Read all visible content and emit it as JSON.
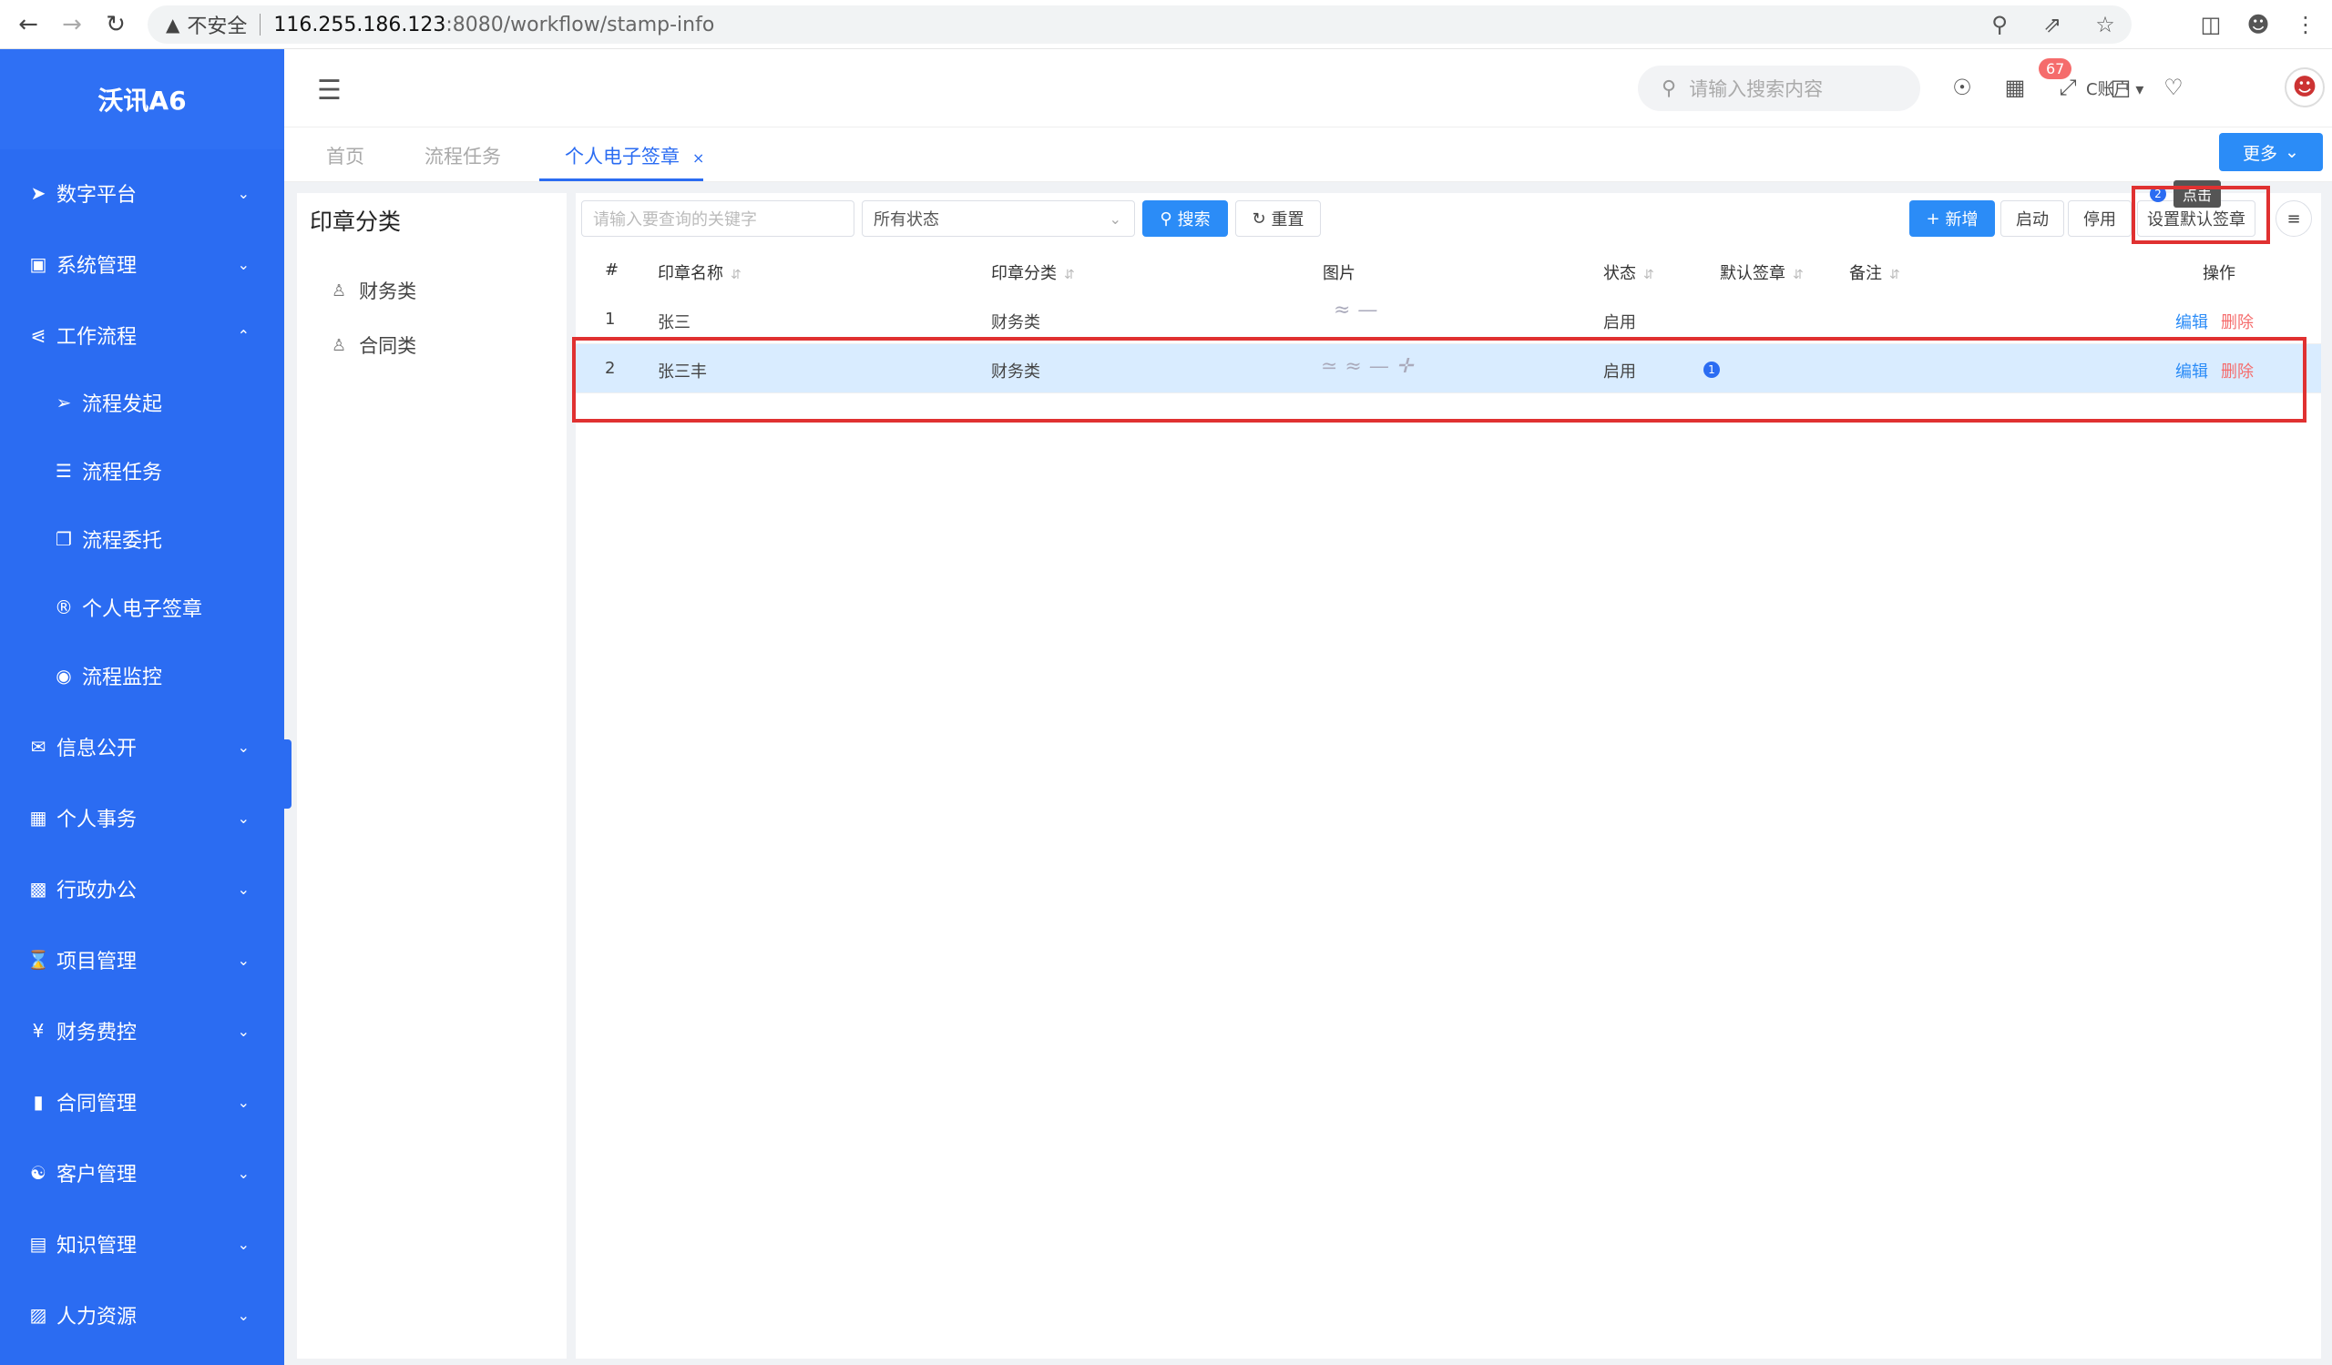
{
  "browser": {
    "insecure_label": "不安全",
    "url_host": "116.255.186.123",
    "url_path": ":8080/workflow/stamp-info"
  },
  "sidebar": {
    "brand": "沃讯A6",
    "menu": [
      {
        "label": "数字平台",
        "icon": "paper-plane-icon"
      },
      {
        "label": "系统管理",
        "icon": "monitor-icon"
      },
      {
        "label": "工作流程",
        "icon": "share-icon"
      },
      {
        "label": "信息公开",
        "icon": "chat-icon"
      },
      {
        "label": "个人事务",
        "icon": "id-card-icon"
      },
      {
        "label": "行政办公",
        "icon": "briefcase-icon"
      },
      {
        "label": "项目管理",
        "icon": "hourglass-icon"
      },
      {
        "label": "财务费控",
        "icon": "yen-icon"
      },
      {
        "label": "合同管理",
        "icon": "file-icon"
      },
      {
        "label": "客户管理",
        "icon": "handshake-icon"
      },
      {
        "label": "知识管理",
        "icon": "book-icon"
      },
      {
        "label": "人力资源",
        "icon": "user-square-icon"
      }
    ],
    "submenu": [
      {
        "label": "流程发起",
        "icon": "arrow-circle-icon"
      },
      {
        "label": "流程任务",
        "icon": "list-icon"
      },
      {
        "label": "流程委托",
        "icon": "copy-icon"
      },
      {
        "label": "个人电子签章",
        "icon": "registered-icon"
      },
      {
        "label": "流程监控",
        "icon": "eye-icon"
      }
    ]
  },
  "header": {
    "search_placeholder": "请输入搜索内容",
    "notification_count": "67",
    "account_label": "C账户"
  },
  "tabs": {
    "items": [
      "首页",
      "流程任务",
      "个人电子签章"
    ],
    "more_label": "更多"
  },
  "categories": {
    "title": "印章分类",
    "items": [
      "财务类",
      "合同类"
    ]
  },
  "toolbar": {
    "keyword_placeholder": "请输入要查询的关键字",
    "status_value": "所有状态",
    "search_label": "搜索",
    "reset_label": "重置",
    "add_label": "新增",
    "enable_label": "启动",
    "disable_label": "停用",
    "set_default_label": "设置默认签章",
    "tooltip": "点击",
    "step_1": "1",
    "step_2": "2"
  },
  "table": {
    "headers": [
      "#",
      "印章名称",
      "印章分类",
      "图片",
      "状态",
      "默认签章",
      "备注",
      "操作"
    ],
    "rows": [
      {
        "index": "1",
        "name": "张三",
        "category": "财务类",
        "status": "启用",
        "edit": "编辑",
        "delete": "删除"
      },
      {
        "index": "2",
        "name": "张三丰",
        "category": "财务类",
        "status": "启用",
        "edit": "编辑",
        "delete": "删除"
      }
    ]
  },
  "colors": {
    "sidebar": "#2b6cf2",
    "primary": "#2b8cf7",
    "danger": "#f56c6c",
    "highlight": "#e03131"
  }
}
